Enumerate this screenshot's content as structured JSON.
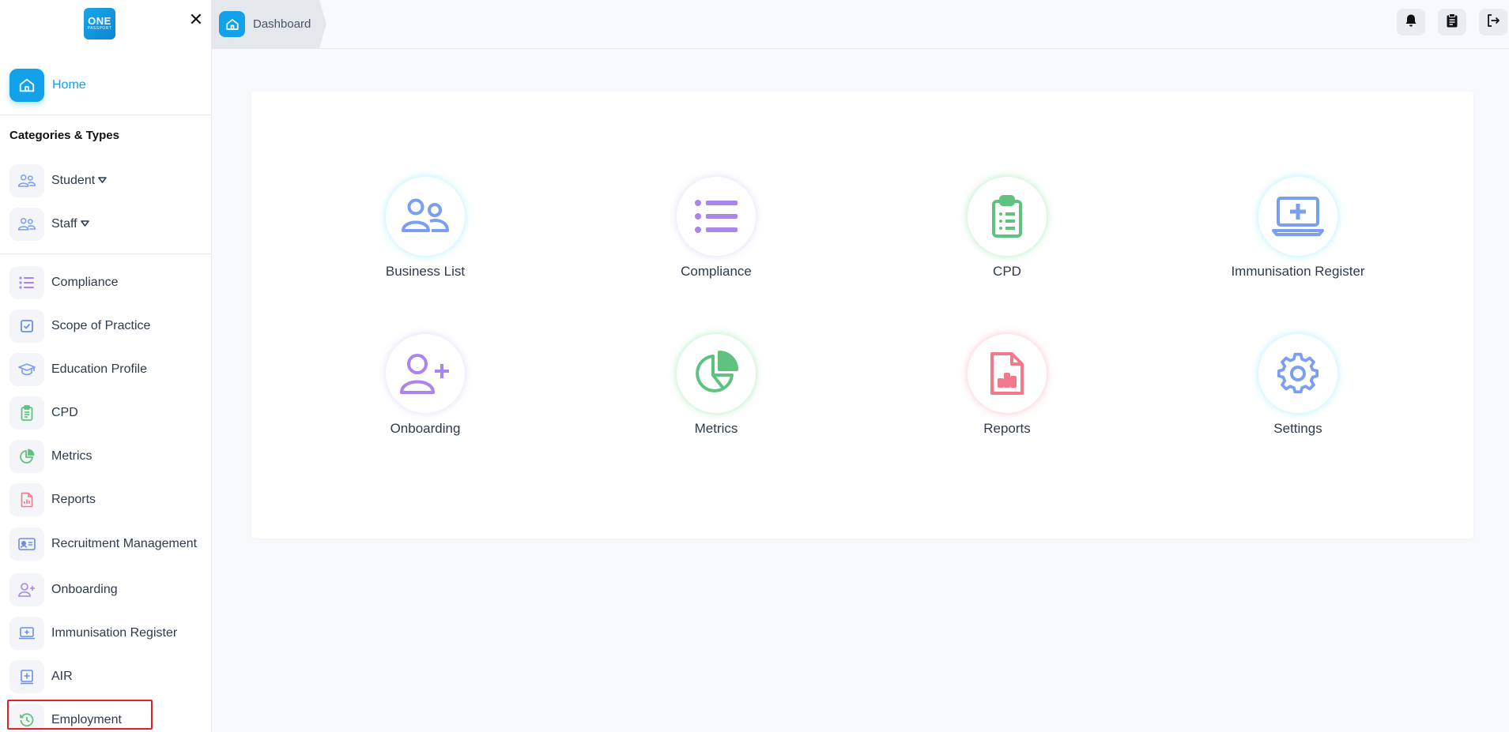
{
  "logo": {
    "line1": "ONE",
    "line2": "PASSPORT"
  },
  "sidebar": {
    "close_symbol": "✕",
    "home": {
      "label": "Home",
      "icon": "home-icon"
    },
    "section_title": "Categories & Types",
    "categories": [
      {
        "label": "Student",
        "icon": "users-icon"
      },
      {
        "label": "Staff",
        "icon": "users-icon"
      }
    ],
    "items": [
      {
        "label": "Compliance",
        "icon": "list-icon"
      },
      {
        "label": "Scope of Practice",
        "icon": "checkbox-icon"
      },
      {
        "label": "Education Profile",
        "icon": "graduation-cap-icon"
      },
      {
        "label": "CPD",
        "icon": "clipboard-icon"
      },
      {
        "label": "Metrics",
        "icon": "pie-chart-icon"
      },
      {
        "label": "Reports",
        "icon": "report-file-icon"
      },
      {
        "label": "Recruitment Management",
        "icon": "id-card-icon"
      },
      {
        "label": "Onboarding",
        "icon": "user-plus-icon"
      },
      {
        "label": "Immunisation Register",
        "icon": "laptop-medical-icon"
      },
      {
        "label": "AIR",
        "icon": "medical-box-icon"
      },
      {
        "label": "Employment",
        "icon": "history-icon"
      }
    ],
    "highlighted_item": "Employment"
  },
  "topbar": {
    "breadcrumb": {
      "label": "Dashboard",
      "icon": "home-icon"
    },
    "actions": [
      {
        "name": "notifications",
        "icon": "bell-icon"
      },
      {
        "name": "clipboard",
        "icon": "clipboard-icon"
      },
      {
        "name": "logout",
        "icon": "logout-icon"
      }
    ]
  },
  "dashboard": {
    "tiles": [
      {
        "label": "Business List",
        "icon": "users-icon",
        "color": "#7a9ef0"
      },
      {
        "label": "Compliance",
        "icon": "list-icon",
        "color": "#a985ec"
      },
      {
        "label": "CPD",
        "icon": "clipboard-icon",
        "color": "#5fc37f"
      },
      {
        "label": "Immunisation Register",
        "icon": "laptop-medical-icon",
        "color": "#7a9ef0"
      },
      {
        "label": "Onboarding",
        "icon": "user-plus-icon",
        "color": "#a985ec"
      },
      {
        "label": "Metrics",
        "icon": "pie-chart-icon",
        "color": "#5fc37f"
      },
      {
        "label": "Reports",
        "icon": "report-file-icon",
        "color": "#f07a8c"
      },
      {
        "label": "Settings",
        "icon": "gear-icon",
        "color": "#7a9ef0"
      }
    ]
  },
  "colors": {
    "primary": "#13a2e9",
    "highlight_border": "#e0202a"
  }
}
